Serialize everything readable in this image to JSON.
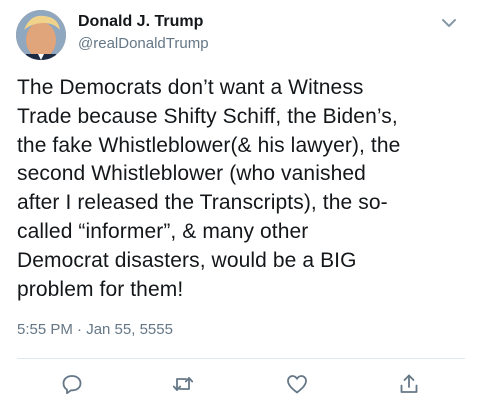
{
  "tweet": {
    "author": {
      "display_name": "Donald J. Trump",
      "handle": "@realDonaldTrump"
    },
    "text": "The Democrats don’t want a Witness\nTrade because Shifty Schiff, the Biden’s,\nthe fake Whistleblower(& his lawyer), the\nsecond Whistleblower (who vanished\nafter I released the Transcripts), the so-\ncalled “informer”, & many other\nDemocrat disasters, would be a BIG\nproblem for them!",
    "timestamp": "5:55 PM · Jan 55, 5555"
  },
  "icons": {
    "menu": "chevron-down-icon",
    "reply": "reply-icon",
    "retweet": "retweet-icon",
    "like": "heart-icon",
    "share": "share-icon"
  },
  "colors": {
    "text": "#14171a",
    "secondary": "#657786",
    "divider": "#e1e8ed",
    "icon": "#657786"
  }
}
